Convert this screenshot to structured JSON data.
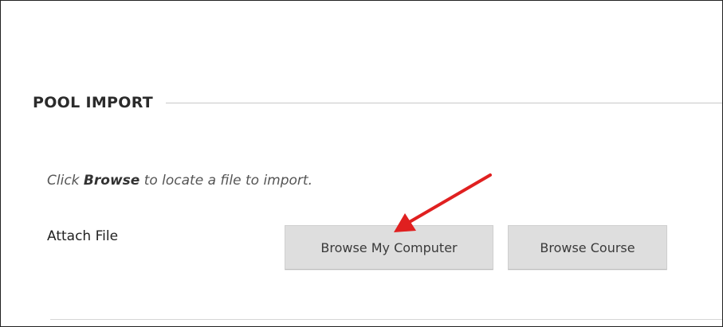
{
  "section": {
    "title": "POOL IMPORT"
  },
  "instruction": {
    "prefix": "Click ",
    "emphasis": "Browse",
    "suffix": " to locate a file to import."
  },
  "attach": {
    "label": "Attach File",
    "browse_computer_label": "Browse My Computer",
    "browse_course_label": "Browse Course"
  },
  "annotation": {
    "arrow_color": "#e02020"
  }
}
